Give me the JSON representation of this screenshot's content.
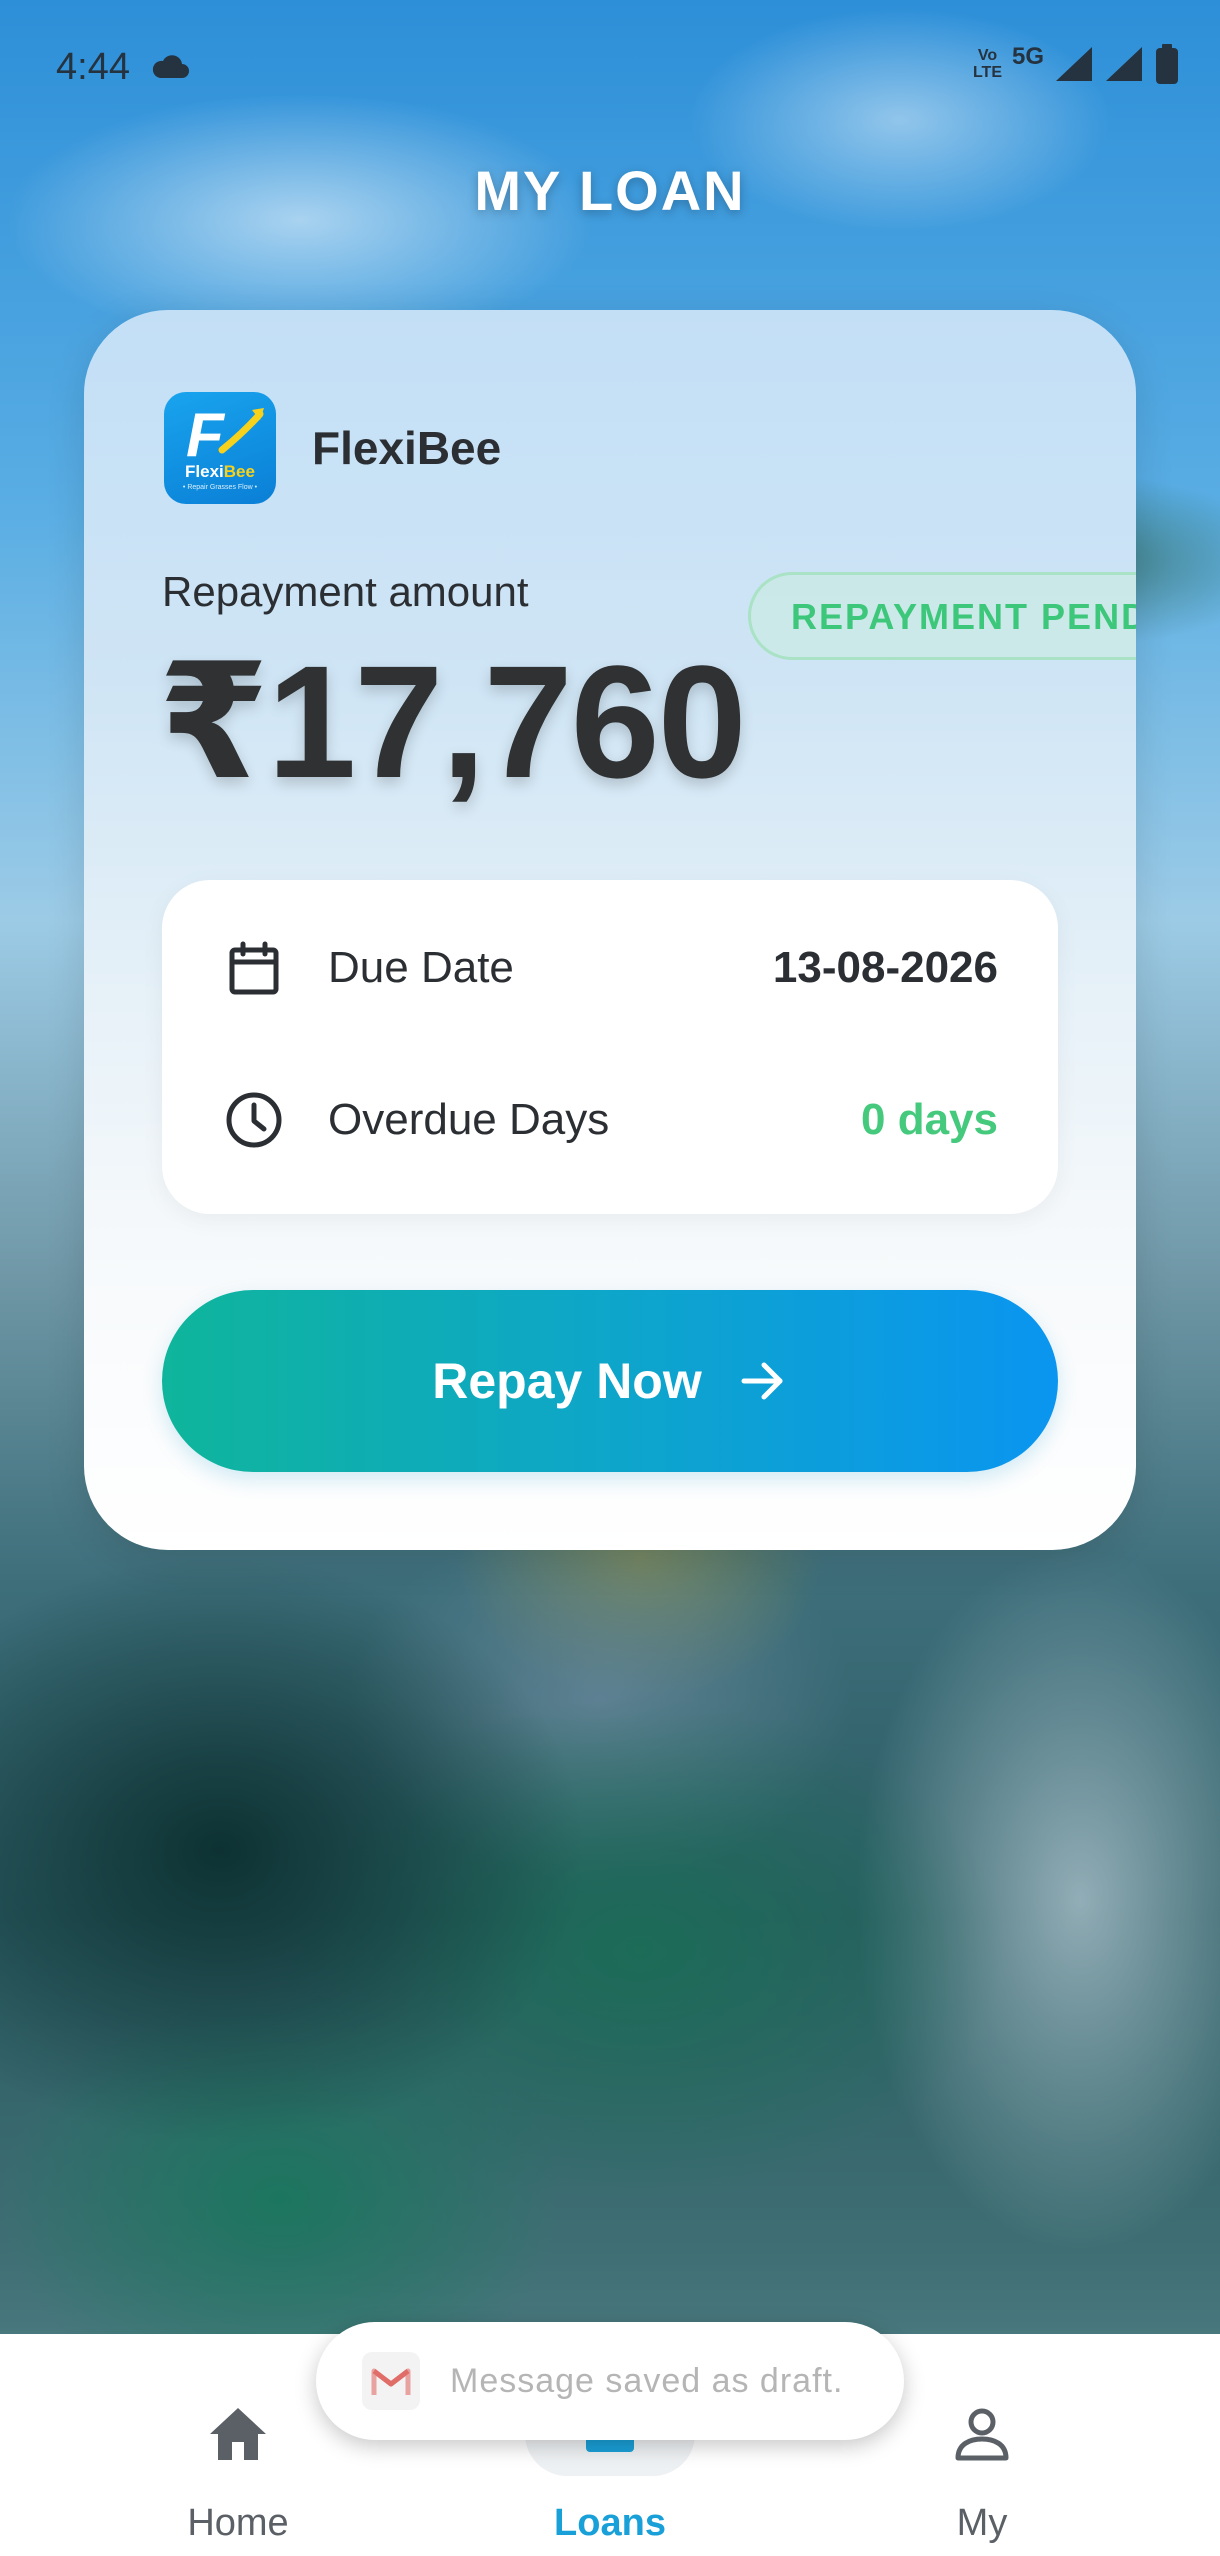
{
  "status_bar": {
    "time": "4:44",
    "volte_top": "Vo",
    "volte_bottom": "LTE",
    "network": "5G",
    "icons": [
      "cloud-icon",
      "signal-icon",
      "signal-icon",
      "battery-icon"
    ]
  },
  "header": {
    "title": "MY LOAN"
  },
  "loan_card": {
    "lender_name": "FlexiBee",
    "logo": {
      "letter": "F",
      "text_primary": "Flexi",
      "text_accent": "Bee",
      "tagline": "• Repair Grasses Flow •"
    },
    "amount_label": "Repayment amount",
    "amount": "₹17,760",
    "status_badge": "REPAYMENT PENDING",
    "details": {
      "due_date_label": "Due Date",
      "due_date_value": "13-08-2026",
      "overdue_label": "Overdue Days",
      "overdue_value": "0 days"
    },
    "repay_button_label": "Repay Now"
  },
  "bottom_nav": {
    "items": [
      {
        "label": "Home",
        "icon": "home-icon"
      },
      {
        "label": "Loans",
        "icon": "loans-icon",
        "active": true
      },
      {
        "label": "My",
        "icon": "person-icon"
      }
    ]
  },
  "toast": {
    "message": "Message saved as draft."
  },
  "colors": {
    "accent_green": "#45c97d",
    "accent_blue": "#1aa0d8",
    "button_gradient_start": "#0fb59b",
    "button_gradient_end": "#0a95f0"
  }
}
